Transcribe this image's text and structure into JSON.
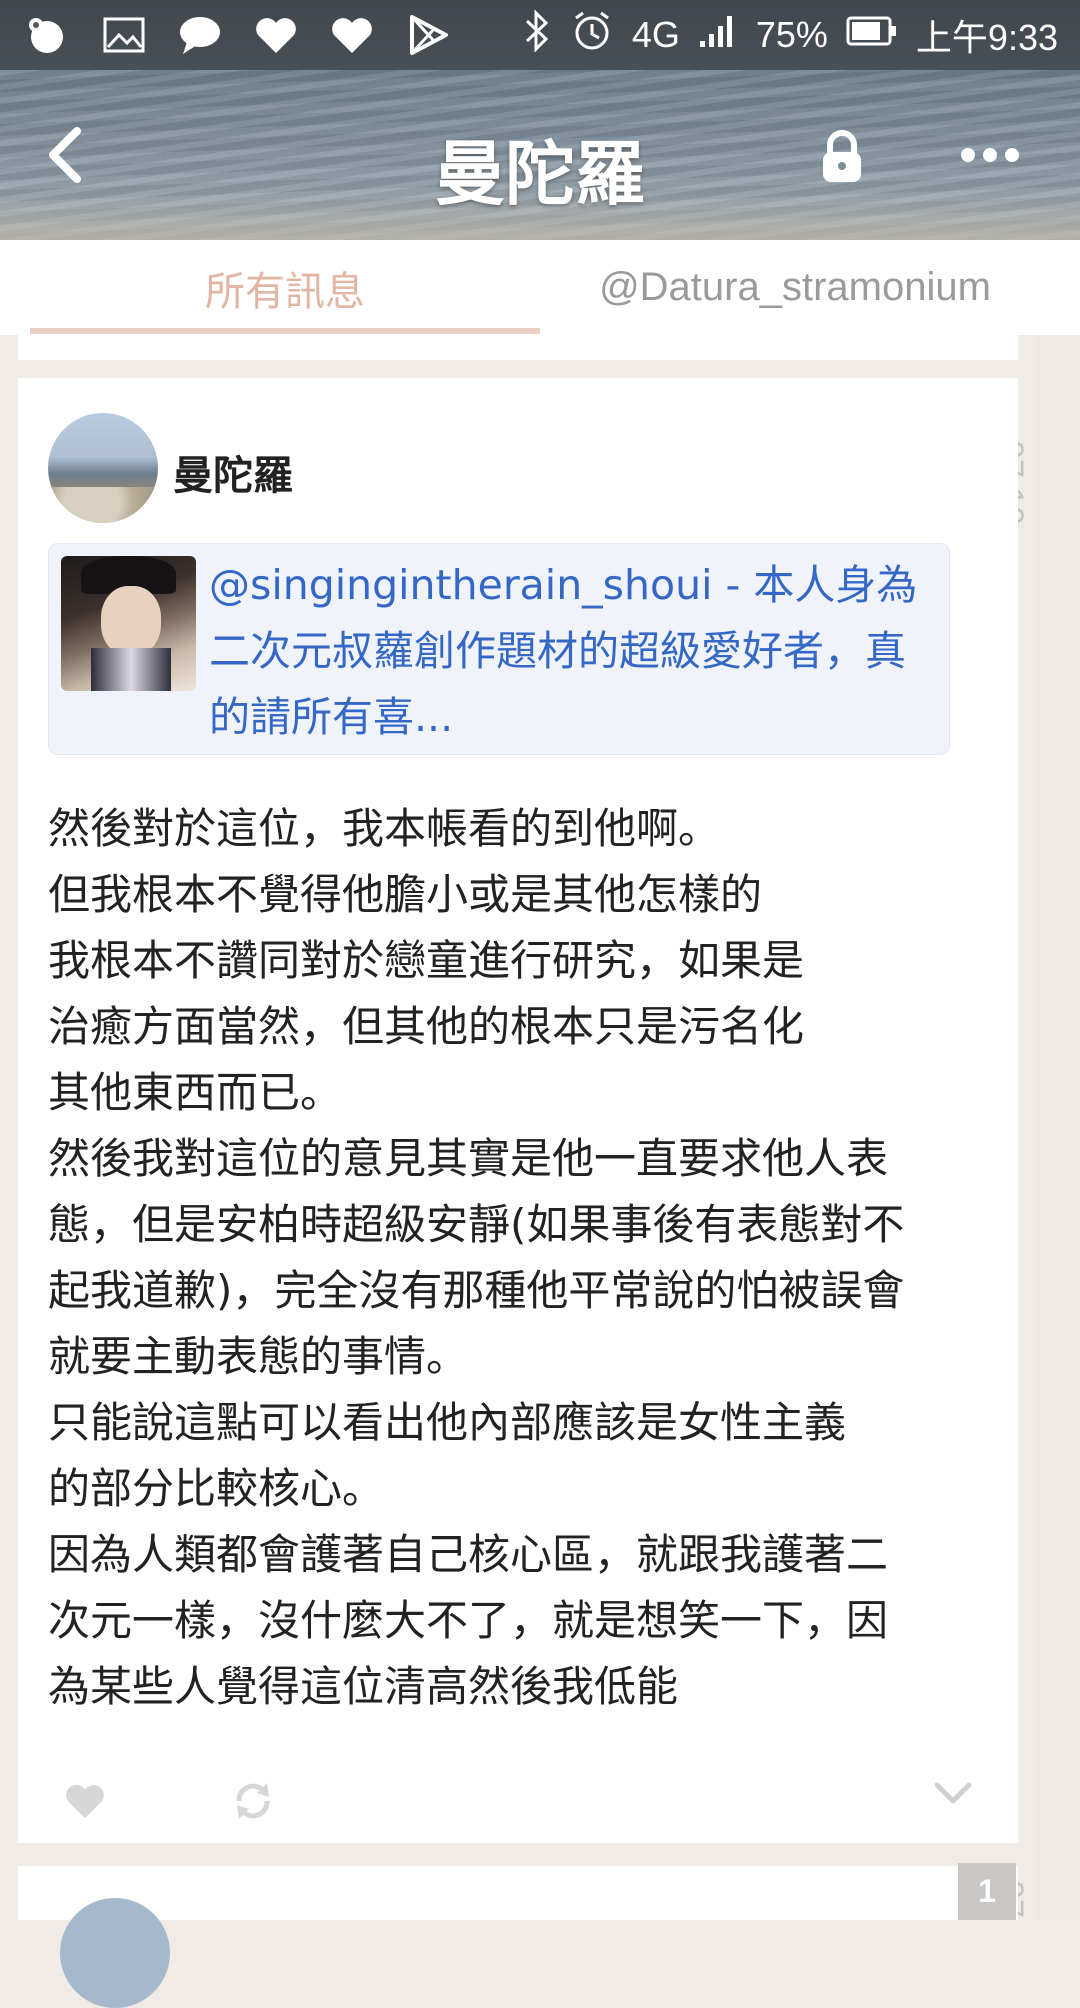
{
  "status_bar": {
    "battery": "75%",
    "network": "4G",
    "time": "上午9:33"
  },
  "header": {
    "title": "曼陀羅"
  },
  "tabs": [
    {
      "label": "所有訊息",
      "active": true
    },
    {
      "label": "@Datura_stramonium",
      "active": false
    }
  ],
  "feed": {
    "time_label": "07:10",
    "next_time_label": "07",
    "post": {
      "author": "曼陀羅",
      "quote": "@singingintherain_shoui - 本人身為二次元叔蘿創作題材的超級愛好者，真的請所有喜...",
      "body": "然後對於這位，我本帳看的到他啊。\n但我根本不覺得他膽小或是其他怎樣的\n我根本不讚同對於戀童進行研究，如果是\n治癒方面當然，但其他的根本只是污名化\n其他東西而已。\n然後我對這位的意見其實是他一直要求他人表\n態，但是安柏時超級安靜(如果事後有表態對不\n起我道歉)，完全沒有那種他平常說的怕被誤會\n就要主動表態的事情。\n只能說這點可以看出他內部應該是女性主義\n的部分比較核心。\n因為人類都會護著自己核心區，就跟我護著二\n次元一樣，沒什麼大不了，就是想笑一下，因\n為某些人覺得這位清高然後我低能",
      "icons": {
        "like": "heart-icon",
        "repost": "repost-icon",
        "expand": "chevron-down-icon"
      }
    },
    "next_badge": "1"
  },
  "colors": {
    "tab_active": "#e2b5a5",
    "quote_link": "#3568c6",
    "feed_background": "#f1ebe8"
  }
}
